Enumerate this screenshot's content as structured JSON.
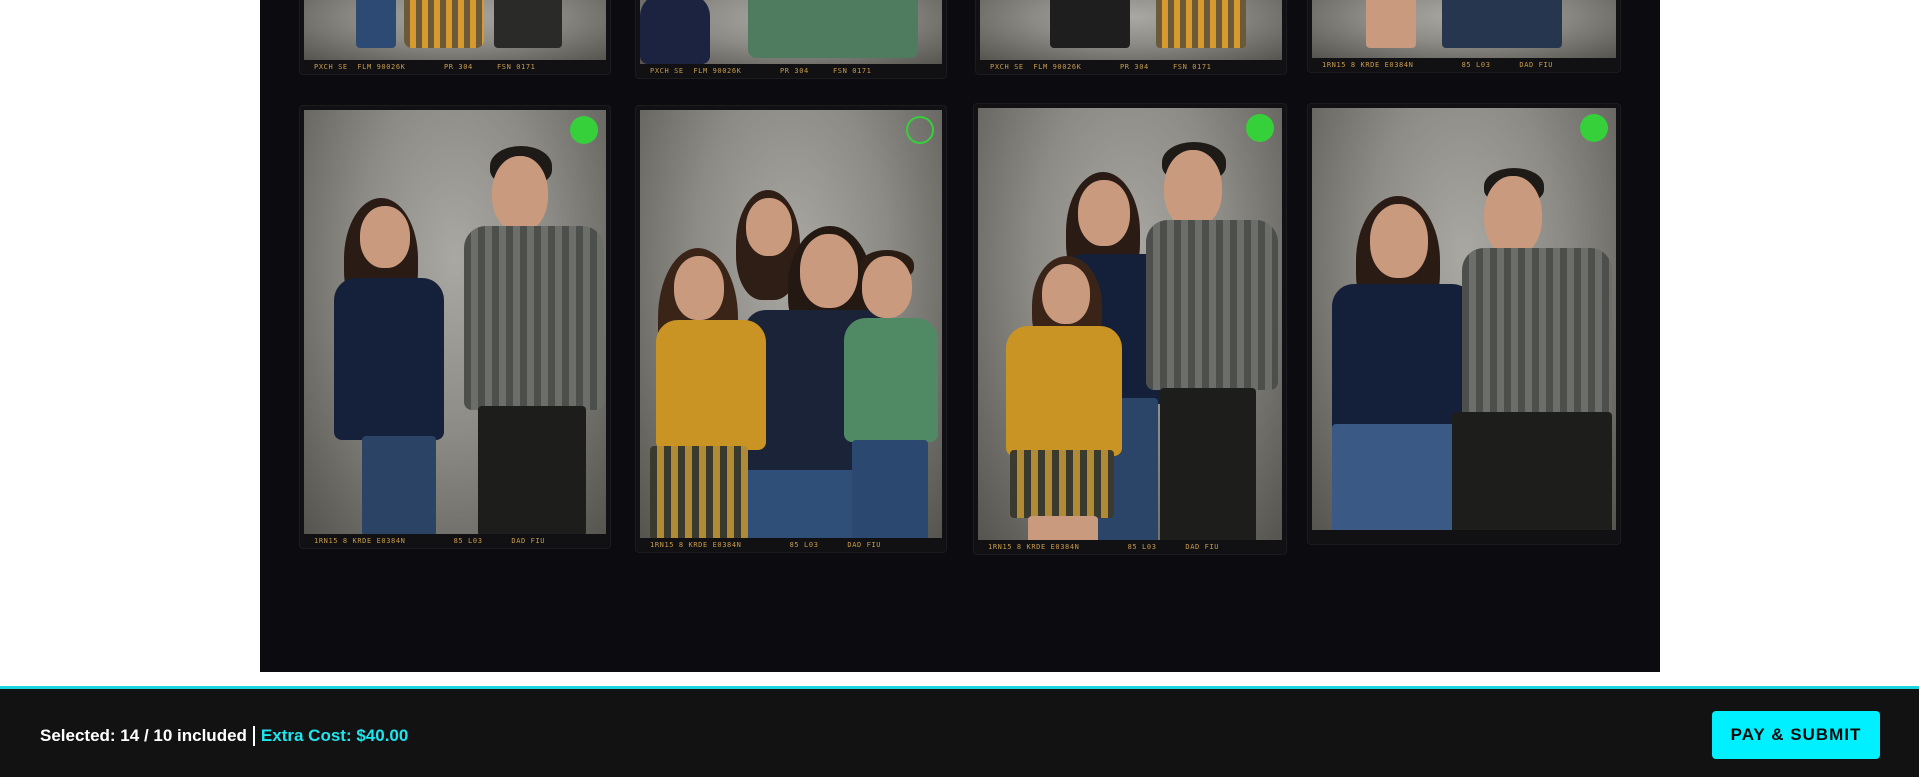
{
  "gallery": {
    "top_row": [
      {
        "edge_text": "PXCH SE  FLM 90026K        PR 304     FSN 0171"
      },
      {
        "edge_text": "PXCH SE  FLM 90026K        PR 304     FSN 0171"
      },
      {
        "edge_text": "PXCH SE  FLM 90026K        PR 304     FSN 0171"
      },
      {
        "edge_text": "1RN15 8 KRDE E0384N          85 L03      DAD FIU"
      }
    ],
    "photos": [
      {
        "selected": true,
        "edge_text": "1RN15 8 KRDE E0384N          85 L03      DAD FIU"
      },
      {
        "selected": false,
        "edge_text": "1RN15 8 KRDE E0384N          85 L03      DAD FIU"
      },
      {
        "selected": true,
        "edge_text": "1RN15 8 KRDE E0384N          85 L03      DAD FIU"
      },
      {
        "selected": true,
        "edge_text": ""
      }
    ]
  },
  "footer": {
    "selected_text": "Selected: 14 / 10 included",
    "extra_cost_text": "Extra Cost: $40.00",
    "pay_button_label": "PAY & SUBMIT"
  },
  "colors": {
    "accent": "#00f0ff",
    "selected_dot": "#35d03a",
    "background": "#0c0c10"
  }
}
